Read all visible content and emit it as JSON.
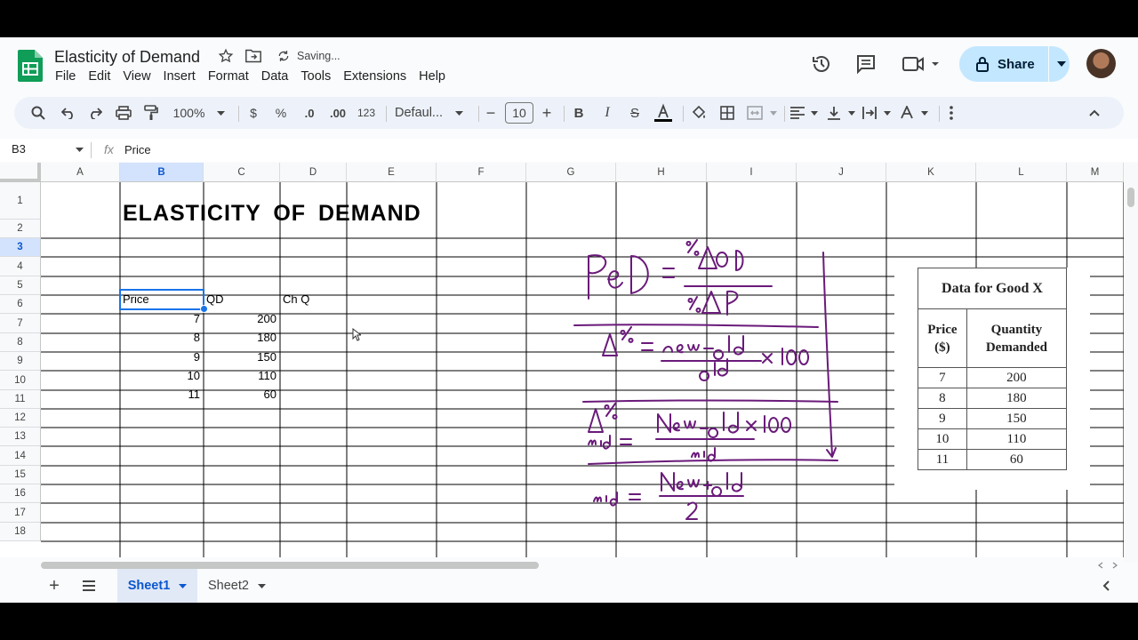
{
  "doc": {
    "title": "Elasticity of Demand",
    "status": "Saving..."
  },
  "menu": [
    "File",
    "Edit",
    "View",
    "Insert",
    "Format",
    "Data",
    "Tools",
    "Extensions",
    "Help"
  ],
  "share": {
    "label": "Share"
  },
  "toolbar": {
    "zoom": "100%",
    "currency": "$",
    "percent": "%",
    "dec_decrease": ".0",
    "dec_increase": ".00",
    "number_format": "123",
    "font": "Defaul...",
    "font_size": "10"
  },
  "formula_bar": {
    "name_box": "B3",
    "fx": "fx",
    "content": "Price"
  },
  "columns": [
    "A",
    "B",
    "C",
    "D",
    "E",
    "F",
    "G",
    "H",
    "I",
    "J",
    "K",
    "L",
    "M"
  ],
  "rows": [
    "1",
    "2",
    "3",
    "4",
    "5",
    "6",
    "7",
    "8",
    "9",
    "10",
    "11",
    "12",
    "13",
    "14",
    "15",
    "16",
    "17",
    "18"
  ],
  "sheet_title": "ELASTICITY  OF  DEMAND",
  "headers": {
    "price": "Price",
    "qd": "QD",
    "chq": "Ch Q"
  },
  "data": {
    "price": [
      "7",
      "8",
      "9",
      "10",
      "11"
    ],
    "qd": [
      "200",
      "180",
      "150",
      "110",
      "60"
    ]
  },
  "image_table": {
    "title": "Data for Good X",
    "col1": [
      "Price",
      "($)"
    ],
    "col2": [
      "Quantity",
      "Demanded"
    ],
    "rows": [
      [
        "7",
        "200"
      ],
      [
        "8",
        "180"
      ],
      [
        "9",
        "150"
      ],
      [
        "10",
        "110"
      ],
      [
        "11",
        "60"
      ]
    ]
  },
  "tabs": [
    "Sheet1",
    "Sheet2"
  ],
  "colors": {
    "accent": "#1a73e8",
    "ink": "#6a1a7a",
    "share_bg": "#c2e7ff"
  }
}
